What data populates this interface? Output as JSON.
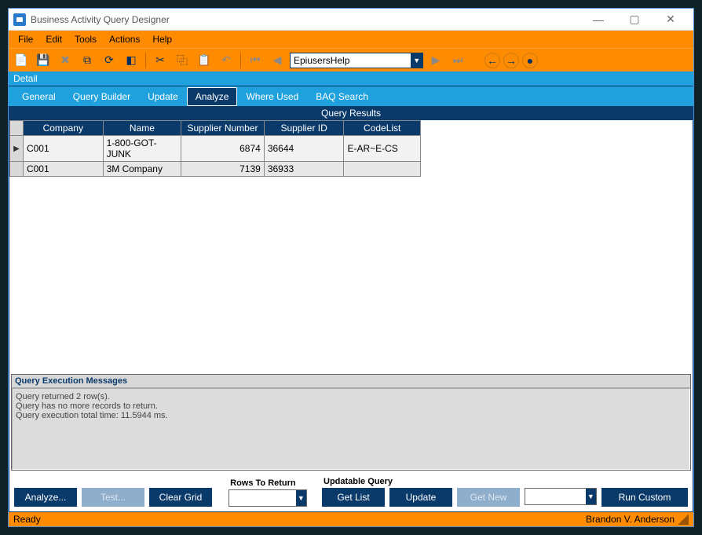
{
  "titlebar": {
    "title": "Business Activity Query Designer"
  },
  "menubar": {
    "items": [
      "File",
      "Edit",
      "Tools",
      "Actions",
      "Help"
    ]
  },
  "toolbar": {
    "icons": [
      {
        "name": "new-icon",
        "glyph": "📄",
        "enabled": true
      },
      {
        "name": "save-icon",
        "glyph": "💾",
        "enabled": true
      },
      {
        "name": "delete-icon",
        "glyph": "✖",
        "enabled": false
      },
      {
        "name": "copy-record-icon",
        "glyph": "⧉",
        "enabled": true
      },
      {
        "name": "refresh-icon",
        "glyph": "⟳",
        "enabled": true
      },
      {
        "name": "clear-icon",
        "glyph": "◧",
        "enabled": true
      }
    ],
    "clipboard_icons": [
      {
        "name": "cut-icon",
        "glyph": "✂",
        "enabled": true
      },
      {
        "name": "copy-icon",
        "glyph": "⿻",
        "enabled": true
      },
      {
        "name": "paste-icon",
        "glyph": "📋",
        "enabled": false
      },
      {
        "name": "undo-icon",
        "glyph": "↶",
        "enabled": false
      }
    ],
    "nav_icons_left": [
      {
        "name": "first-icon",
        "glyph": "⏮",
        "enabled": false
      },
      {
        "name": "prev-icon",
        "glyph": "◀",
        "enabled": false
      }
    ],
    "nav_icons_right": [
      {
        "name": "next-icon",
        "glyph": "▶",
        "enabled": false
      },
      {
        "name": "last-icon",
        "glyph": "⏭",
        "enabled": false
      }
    ],
    "circle_icons": [
      {
        "name": "nav-back-icon",
        "glyph": "←"
      },
      {
        "name": "nav-forward-icon",
        "glyph": "→"
      },
      {
        "name": "nav-home-icon",
        "glyph": "●"
      }
    ],
    "query_name": "EpiusersHelp"
  },
  "detail_label": "Detail",
  "tabs": [
    {
      "label": "General",
      "active": false
    },
    {
      "label": "Query Builder",
      "active": false
    },
    {
      "label": "Update",
      "active": false
    },
    {
      "label": "Analyze",
      "active": true
    },
    {
      "label": "Where Used",
      "active": false
    },
    {
      "label": "BAQ Search",
      "active": false
    }
  ],
  "grid": {
    "title": "Query Results",
    "columns": [
      "Company",
      "Name",
      "Supplier Number",
      "Supplier ID",
      "CodeList"
    ],
    "rows": [
      {
        "selected": true,
        "cells": [
          "C001",
          "1-800-GOT-JUNK",
          "6874",
          "36644",
          "E-AR~E-CS"
        ]
      },
      {
        "selected": false,
        "cells": [
          "C001",
          "3M Company",
          "7139",
          "36933",
          ""
        ]
      }
    ]
  },
  "messages": {
    "title": "Query Execution Messages",
    "lines": [
      "Query returned 2 row(s).",
      "Query has no more records to return.",
      "Query execution total time: 11.5944 ms."
    ]
  },
  "bottom": {
    "analyze_label": "Analyze...",
    "test_label": "Test...",
    "clear_label": "Clear Grid",
    "rows_group": "Rows To Return",
    "rows_value": "",
    "updatable_group": "Updatable Query",
    "getlist_label": "Get List",
    "update_label": "Update",
    "getnew_label": "Get New",
    "runcustom_label": "Run Custom",
    "custom_value": ""
  },
  "statusbar": {
    "status": "Ready",
    "user": "Brandon V. Anderson"
  }
}
